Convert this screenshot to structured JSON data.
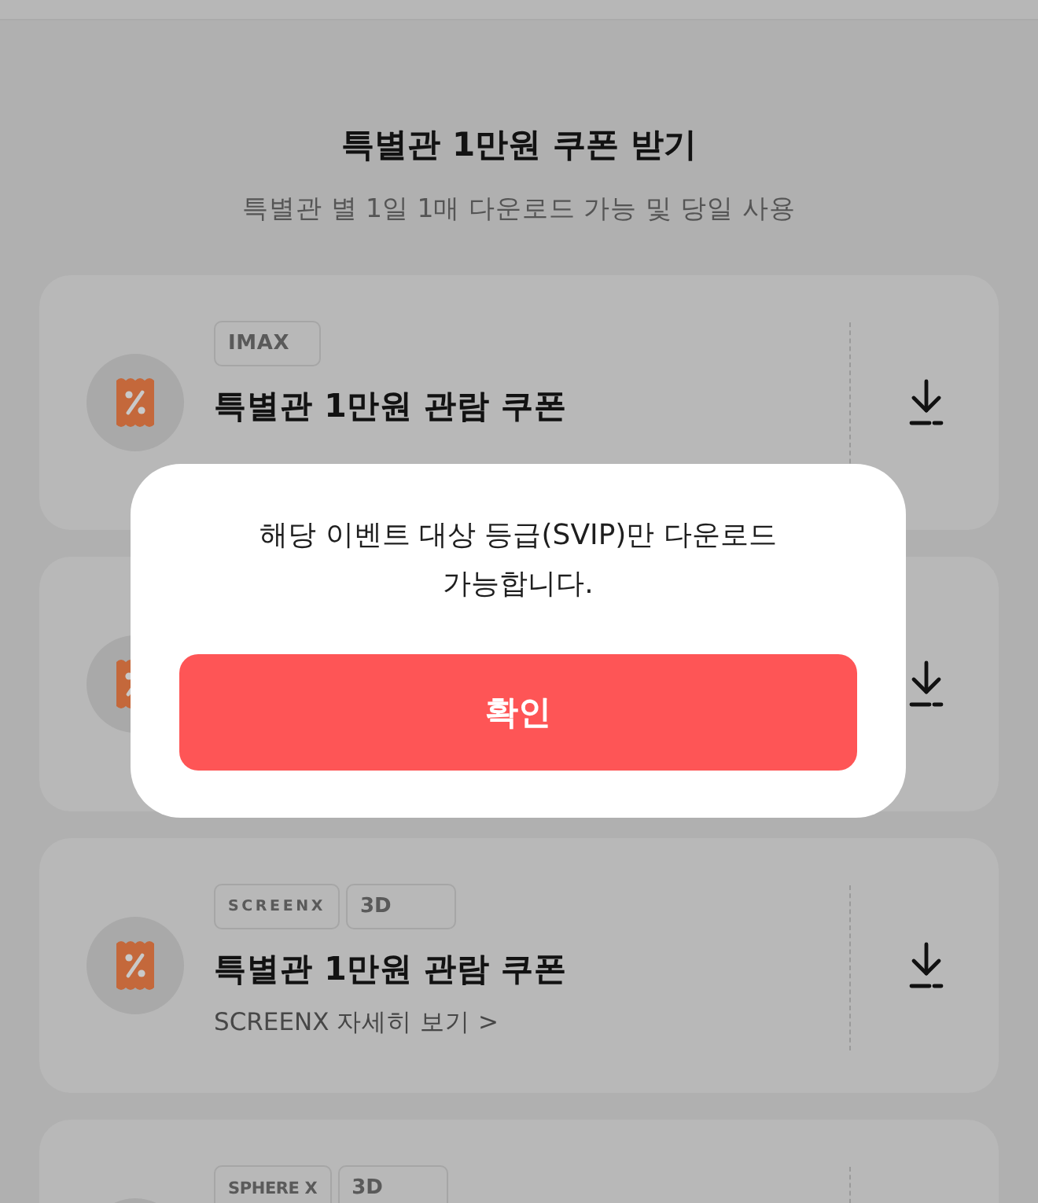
{
  "header": {
    "title": "특별관 1만원 쿠폰 받기",
    "subtitle": "특별관 별 1일 1매 다운로드 가능 및 당일 사용"
  },
  "coupons": [
    {
      "kind": "coupon",
      "tags": [
        {
          "kind": "imax",
          "label": "IMAX"
        }
      ],
      "title": "특별관 1만원 관람 쿠폰"
    },
    {
      "kind": "coupon"
    },
    {
      "kind": "coupon",
      "tags": [
        {
          "kind": "screenx",
          "label": "SCREENX"
        },
        {
          "kind": "threed",
          "label": "3D"
        }
      ],
      "title": "특별관 1만원 관람 쿠폰",
      "link": "SCREENX 자세히 보기 >"
    },
    {
      "kind": "coupon",
      "tags": [
        {
          "kind": "spherex",
          "label": "SPHERE X"
        },
        {
          "kind": "threed",
          "label": "3D"
        }
      ]
    }
  ],
  "dialog": {
    "message": "해당 이벤트 대상 등급(SVIP)만 다운로드\n가능합니다.",
    "confirm": "확인"
  }
}
